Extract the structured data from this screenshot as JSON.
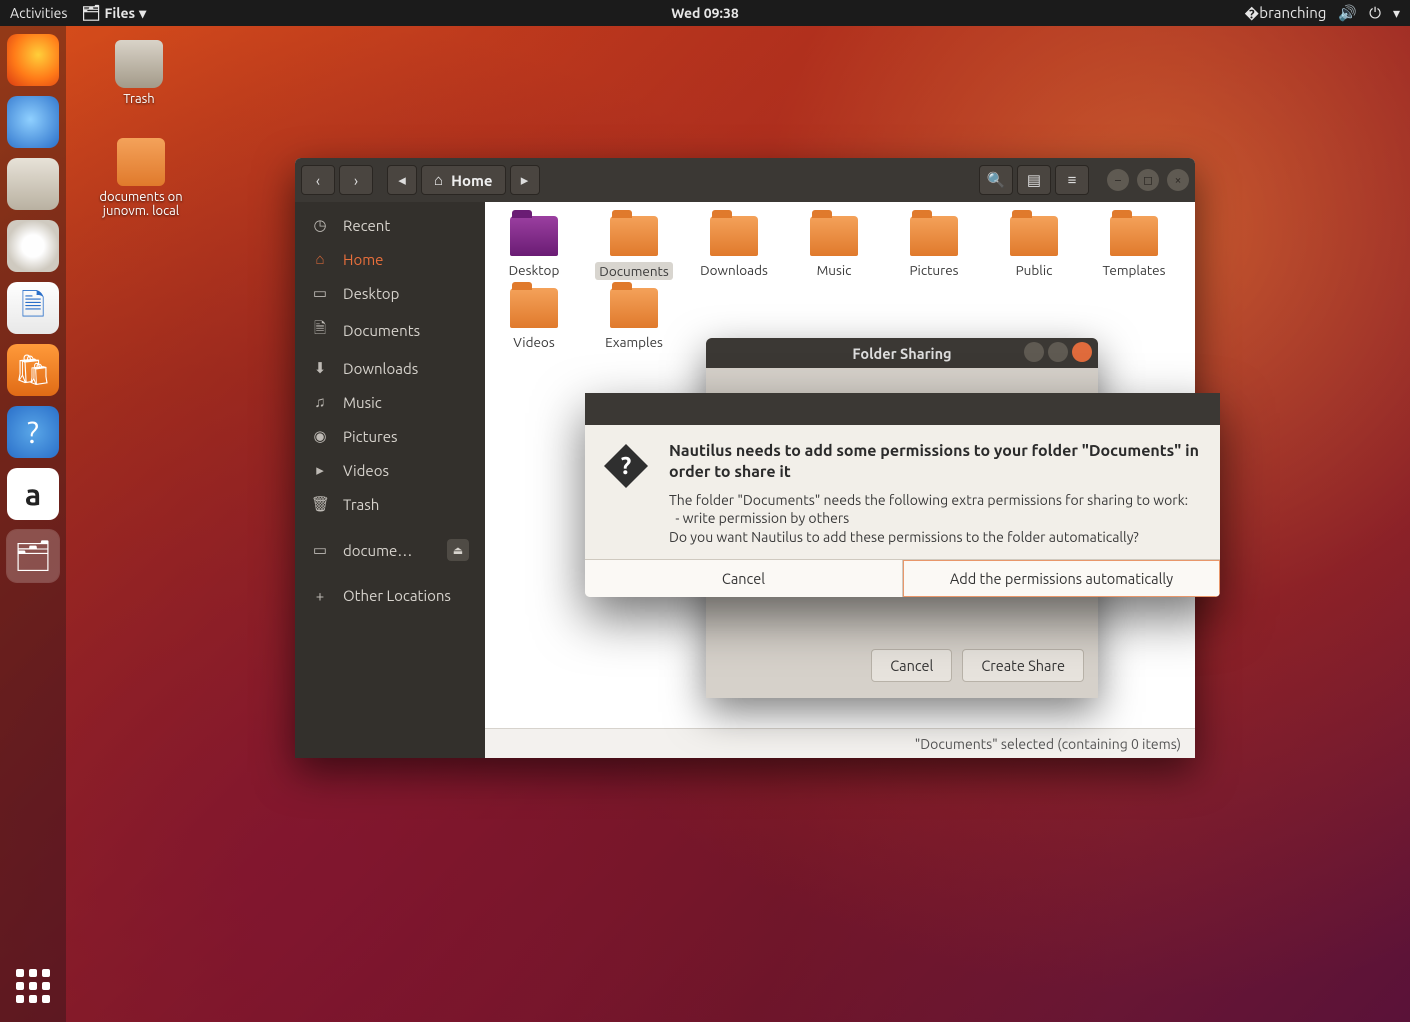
{
  "topbar": {
    "activities": "Activities",
    "files_label": "Files",
    "clock": "Wed 09:38"
  },
  "desktop": {
    "trash": "Trash",
    "share": "documents on junovm. local"
  },
  "dock": {
    "items": [
      "firefox",
      "thunderbird",
      "files",
      "rhythmbox",
      "writer",
      "software",
      "help",
      "amazon",
      "files-active"
    ]
  },
  "nautilus": {
    "path_label": "Home",
    "sidebar": {
      "items": [
        {
          "icon": "◷",
          "label": "Recent"
        },
        {
          "icon": "⌂",
          "label": "Home",
          "active": true
        },
        {
          "icon": "▭",
          "label": "Desktop"
        },
        {
          "icon": "🗎",
          "label": "Documents"
        },
        {
          "icon": "⬇",
          "label": "Downloads"
        },
        {
          "icon": "♫",
          "label": "Music"
        },
        {
          "icon": "◉",
          "label": "Pictures"
        },
        {
          "icon": "▸",
          "label": "Videos"
        },
        {
          "icon": "🗑",
          "label": "Trash"
        }
      ],
      "mount": {
        "icon": "▭",
        "label": "docume…"
      },
      "other": {
        "icon": "+",
        "label": "Other Locations"
      }
    },
    "folders": [
      {
        "label": "Desktop",
        "kind": "desktop"
      },
      {
        "label": "Documents",
        "selected": true
      },
      {
        "label": "Downloads"
      },
      {
        "label": "Music"
      },
      {
        "label": "Pictures"
      },
      {
        "label": "Public"
      },
      {
        "label": "Templates"
      },
      {
        "label": "Videos"
      },
      {
        "label": "Examples"
      }
    ],
    "status": "\"Documents\" selected  (containing 0 items)"
  },
  "share_window": {
    "title": "Folder Sharing",
    "cancel": "Cancel",
    "create": "Create Share"
  },
  "dialog": {
    "heading": "Nautilus needs to add some permissions to your folder \"Documents\" in order to share it",
    "body_l1": "The folder \"Documents\" needs the following extra permissions for sharing to work:",
    "body_l2": "  - write permission by others",
    "body_l3": "Do you want Nautilus to add these permissions to the folder automatically?",
    "cancel": "Cancel",
    "confirm": "Add the permissions automatically"
  }
}
